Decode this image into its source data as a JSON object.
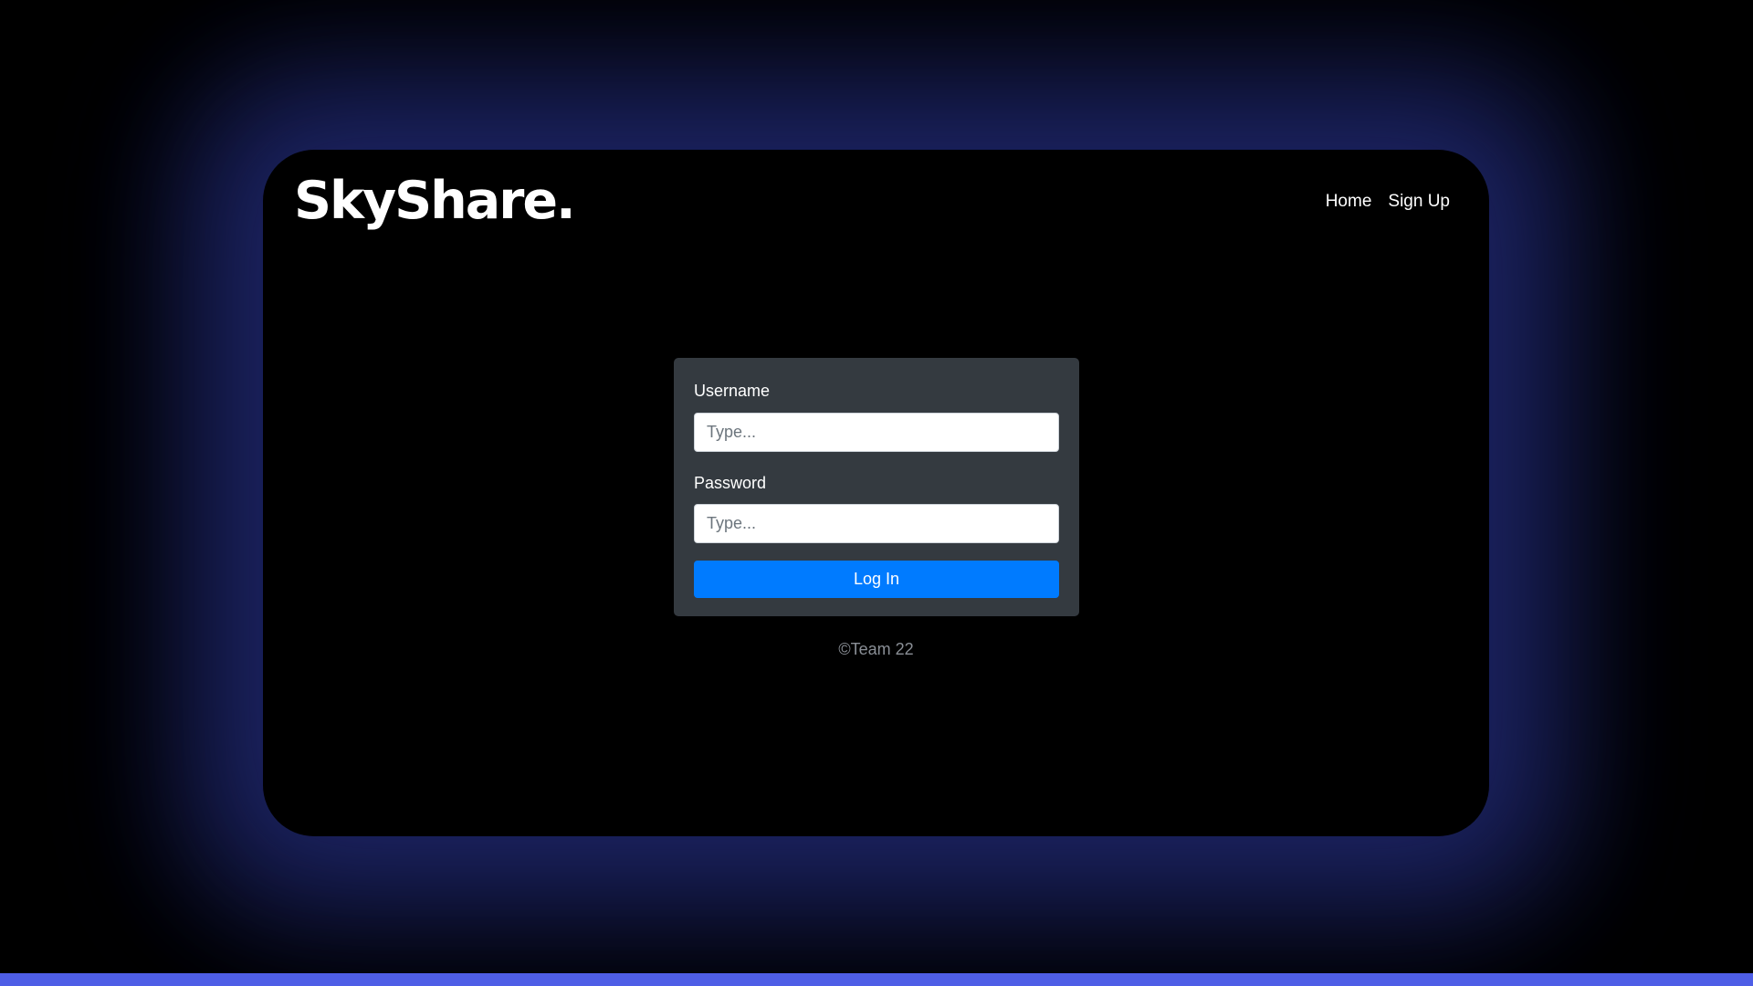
{
  "app": {
    "brand": "SkyShare."
  },
  "nav": {
    "items": [
      {
        "label": "Home"
      },
      {
        "label": "Sign Up"
      }
    ]
  },
  "login": {
    "username_label": "Username",
    "username_placeholder": "Type...",
    "username_value": "",
    "password_label": "Password",
    "password_placeholder": "Type...",
    "password_value": "",
    "submit_label": "Log In"
  },
  "footer": {
    "text": "©Team 22"
  },
  "colors": {
    "page_background": "#000000",
    "glow": "#2b3796",
    "form_background": "#343a40",
    "primary_button": "#007bff",
    "bottom_bar": "#4e5ee6"
  }
}
